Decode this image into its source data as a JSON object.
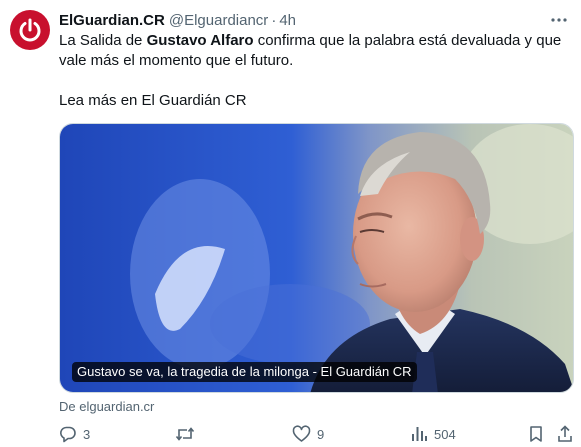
{
  "tweet": {
    "display_name": "ElGuardian.CR",
    "handle": "@Elguardiancr",
    "separator": "·",
    "time": "4h",
    "text_before": "La Salida de ",
    "text_bold": "Gustavo Alfaro",
    "text_after": " confirma que la palabra está devaluada y que vale más el momento que el futuro.",
    "text_line2": "Lea más en El Guardián CR"
  },
  "card": {
    "title": "Gustavo se va, la tragedia de la milonga - El Guardián CR",
    "source": "De elguardian.cr"
  },
  "actions": {
    "replies": "3",
    "retweets": "",
    "likes": "9",
    "views": "504"
  },
  "icons": {
    "avatar": "power-icon",
    "more": "more-icon",
    "reply": "reply-icon",
    "retweet": "retweet-icon",
    "like": "heart-icon",
    "views": "views-icon",
    "bookmark": "bookmark-icon",
    "share": "share-icon"
  },
  "colors": {
    "brand": "#c8102e",
    "text": "#0f1419",
    "secondary": "#536471",
    "photo_blue": "#2a56c8"
  }
}
